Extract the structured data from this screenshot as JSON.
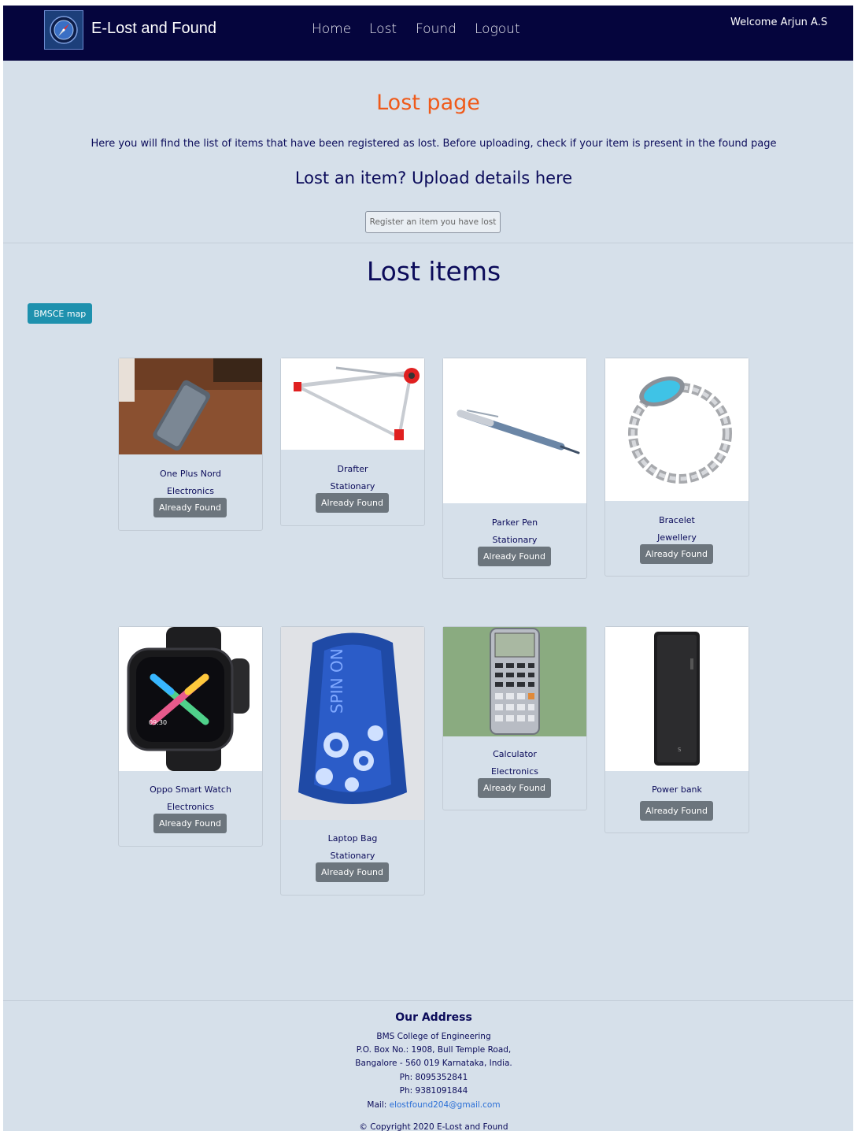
{
  "navbar": {
    "brand": "E-Lost and Found",
    "links": [
      "Home",
      "Lost",
      "Found",
      "Logout"
    ],
    "welcome": "Welcome Arjun A.S"
  },
  "hero": {
    "title": "Lost page",
    "description": "Here you will find the list of items that have been registered as lost. Before uploading, check if your item is present in the found page",
    "upload_title": "Lost an item? Upload details here",
    "register_button": "Register an item you have lost"
  },
  "lost_section": {
    "title": "Lost items",
    "map_button": "BMSCE map"
  },
  "items": [
    {
      "name": "One Plus Nord",
      "category": "Electronics",
      "button": "Already Found"
    },
    {
      "name": "Drafter",
      "category": "Stationary",
      "button": "Already Found"
    },
    {
      "name": "Parker Pen",
      "category": "Stationary",
      "button": "Already Found"
    },
    {
      "name": "Bracelet",
      "category": "Jewellery",
      "button": "Already Found"
    },
    {
      "name": "Oppo Smart Watch",
      "category": "Electronics",
      "button": "Already Found"
    },
    {
      "name": "Laptop Bag",
      "category": "Stationary",
      "button": "Already Found"
    },
    {
      "name": "Calculator",
      "category": "Electronics",
      "button": "Already Found"
    },
    {
      "name": "Power bank",
      "category": "",
      "button": "Already Found"
    }
  ],
  "footer": {
    "title": "Our Address",
    "lines": [
      "BMS College of Engineering",
      "P.O. Box No.: 1908, Bull Temple Road,",
      "Bangalore - 560 019 Karnataka, India.",
      "Ph: 8095352841",
      "Ph: 9381091844"
    ],
    "mail_label": "Mail:",
    "mail": "elostfound204@gmail.com",
    "copyright": "© Copyright 2020 E-Lost and Found"
  },
  "colors": {
    "navbar": "#05053d",
    "page_bg": "#d6e0ea",
    "accent_title": "#ef5a1a",
    "heading": "#0b0b5a",
    "map_button": "#1e91ae",
    "found_button": "#6c757d"
  }
}
